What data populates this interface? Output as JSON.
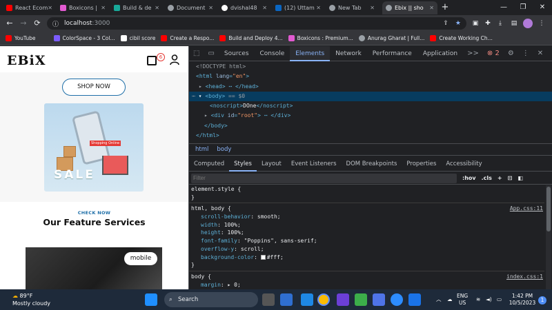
{
  "tabs": [
    {
      "title": "React Ecom",
      "color": "#ff0000"
    },
    {
      "title": "Boxicons | ",
      "color": "#e25ad1"
    },
    {
      "title": "Build & de",
      "color": "#18a999"
    },
    {
      "title": "Document",
      "color": "#9aa0a6"
    },
    {
      "title": "dvishal48",
      "color": "#ffffff"
    },
    {
      "title": "(12) Uttam",
      "color": "#0a66c2"
    },
    {
      "title": "New Tab",
      "color": "#9aa0a6"
    },
    {
      "title": "Ebix || sho",
      "color": "#9aa0a6",
      "active": true
    }
  ],
  "address": {
    "host": "localhost",
    "port": ":3000"
  },
  "bookmarks": [
    {
      "label": "YouTube",
      "color": "#ff0000"
    },
    {
      "label": "ColorSpace - 3 Col...",
      "color": "#7c5cff"
    },
    {
      "label": "cibil score",
      "color": "#ffffff"
    },
    {
      "label": "Create a Respo...",
      "color": "#ff0000"
    },
    {
      "label": "Build and Deploy 4...",
      "color": "#ff0000"
    },
    {
      "label": "Boxicons : Premium...",
      "color": "#e25ad1"
    },
    {
      "label": "Anurag Gharat | Full...",
      "color": "#9aa0a6"
    },
    {
      "label": "Create Working Ch...",
      "color": "#ff0000"
    }
  ],
  "site": {
    "logo": "EBiX",
    "cart_count": "6",
    "shop_button": "SHOP NOW",
    "hero_words": [
      "Shopping",
      "Online",
      "SALE"
    ],
    "section_kicker": "CHECK NOW",
    "section_title": "Our Feature Services",
    "service_label": "mobile"
  },
  "devtools": {
    "tabs": [
      "Sources",
      "Console",
      "Elements",
      "Network",
      "Performance",
      "Application"
    ],
    "active_tab": "Elements",
    "more": ">>",
    "error_count": "2",
    "dom": {
      "doctype": "<!DOCTYPE html>",
      "html_open": "<html ",
      "html_attr": "lang",
      "html_val": "\"en\"",
      "head": "<head> ⋯ </head>",
      "body": "<body>",
      "body_eq": " == $0",
      "noscript_open": "<noscript>",
      "noscript_text": "DOne",
      "noscript_close": "</noscript>",
      "div_open": "<div ",
      "div_attr": "id",
      "div_val": "\"root\"",
      "div_rest": "> ⋯ </div>",
      "body_close": "</body>",
      "html_close": "</html>"
    },
    "breadcrumbs": [
      "html",
      "body"
    ],
    "subtabs": [
      "Computed",
      "Styles",
      "Layout",
      "Event Listeners",
      "DOM Breakpoints",
      "Properties",
      "Accessibility"
    ],
    "active_subtab": "Styles",
    "filter_placeholder": "Filter",
    "hov": ":hov",
    "cls": ".cls",
    "styles": {
      "element_style": "element.style {",
      "close": "}",
      "rule1_selector": "html, body {",
      "rule1_source": "App.css:11",
      "rule1_props": [
        {
          "name": "scroll-behavior",
          "value": "smooth;"
        },
        {
          "name": "width",
          "value": "100%;"
        },
        {
          "name": "height",
          "value": "100%;"
        },
        {
          "name": "font-family",
          "value": "\"Poppins\", sans-serif;"
        },
        {
          "name": "overflow-y",
          "value": "scroll;"
        },
        {
          "name": "background-color",
          "value": "#fff;"
        }
      ],
      "rule2_selector": "body {",
      "rule2_source": "index.css:1",
      "rule2_prop": {
        "name": "margin",
        "value": "▸ 0;"
      }
    }
  },
  "taskbar": {
    "temp": "89°F",
    "weather": "Mostly cloudy",
    "search": "Search",
    "lang1": "ENG",
    "lang2": "US",
    "time": "1:42 PM",
    "date": "10/5/2023"
  }
}
